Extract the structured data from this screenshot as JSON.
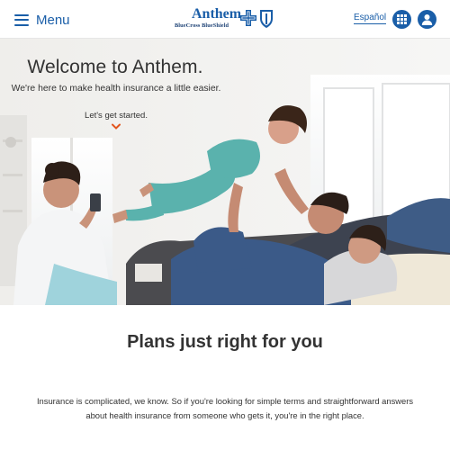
{
  "header": {
    "menu_label": "Menu",
    "logo": {
      "brand": "Anthem.",
      "subbrand": "BlueCross BlueShield"
    },
    "language_link": "Español",
    "icons": {
      "menu": "hamburger-icon",
      "apps": "grid-apps-icon",
      "account": "user-account-icon"
    },
    "brand_color": "#1a5ea8"
  },
  "hero": {
    "title": "Welcome to Anthem.",
    "subtitle": "We're here to make health insurance a little easier.",
    "cta": "Let's get started.",
    "cta_icon": "chevron-down-icon",
    "cta_icon_color": "#e2541d"
  },
  "content": {
    "title": "Plans just right for you",
    "body": "Insurance is complicated, we know. So if you're looking for simple terms and straightforward answers about health insurance from someone who gets it, you're in the right place."
  }
}
